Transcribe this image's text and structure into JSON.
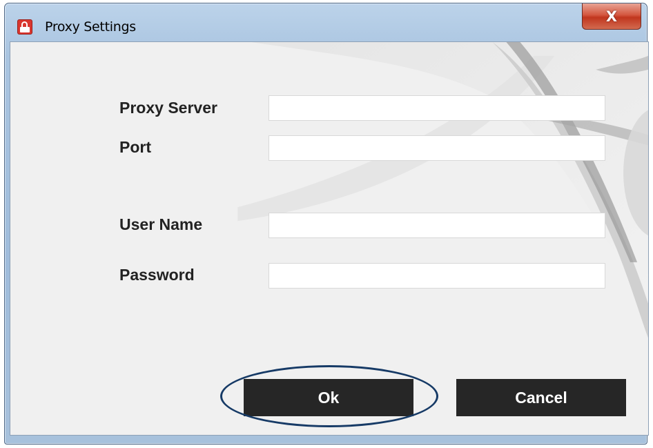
{
  "window": {
    "title": "Proxy Settings",
    "close_label": "X",
    "icon": "lock-icon"
  },
  "form": {
    "proxy_server_label": "Proxy Server",
    "proxy_server_value": "",
    "port_label": "Port",
    "port_value": "",
    "user_name_label": "User Name",
    "user_name_value": "",
    "password_label": "Password",
    "password_value": ""
  },
  "buttons": {
    "ok_label": "Ok",
    "cancel_label": "Cancel"
  },
  "colors": {
    "button_bg": "#262626",
    "highlight": "#163a66",
    "close_button": "#c1361e"
  }
}
